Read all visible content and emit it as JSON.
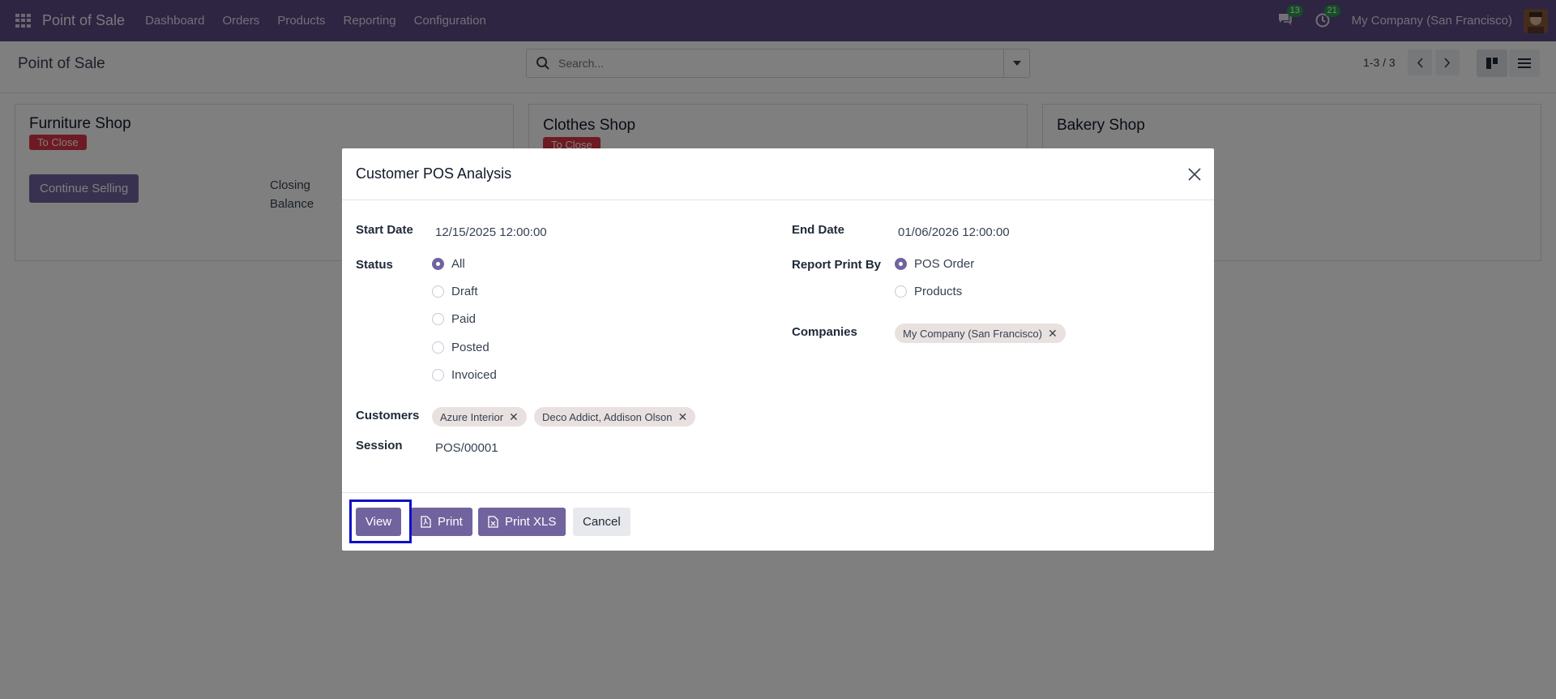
{
  "navbar": {
    "brand": "Point of Sale",
    "menu": [
      "Dashboard",
      "Orders",
      "Products",
      "Reporting",
      "Configuration"
    ],
    "messages_count": "13",
    "activities_count": "21",
    "company": "My Company (San Francisco)"
  },
  "control_panel": {
    "title": "Point of Sale",
    "search_placeholder": "Search...",
    "pager": "1-3 / 3"
  },
  "cards": [
    {
      "title": "Furniture Shop",
      "status": "To Close",
      "button": "Continue Selling",
      "closing_label": "Closing Balance"
    },
    {
      "title": "Clothes Shop",
      "status": "To Close"
    },
    {
      "title": "Bakery Shop"
    }
  ],
  "dialog": {
    "title": "Customer POS Analysis",
    "start_date_label": "Start Date",
    "start_date": "12/15/2025 12:00:00",
    "end_date_label": "End Date",
    "end_date": "01/06/2026 12:00:00",
    "status_label": "Status",
    "status_options": [
      "All",
      "Draft",
      "Paid",
      "Posted",
      "Invoiced"
    ],
    "status_selected": "All",
    "report_print_by_label": "Report Print By",
    "report_options": [
      "POS Order",
      "Products"
    ],
    "report_selected": "POS Order",
    "companies_label": "Companies",
    "companies": [
      "My Company (San Francisco)"
    ],
    "customers_label": "Customers",
    "customers": [
      "Azure Interior",
      "Deco Addict, Addison Olson"
    ],
    "session_label": "Session",
    "session": "POS/00001",
    "buttons": {
      "view": "View",
      "print": "Print",
      "print_xls": "Print XLS",
      "cancel": "Cancel"
    }
  },
  "colors": {
    "navbar": "#5b4a85",
    "primary": "#71639e",
    "danger": "#dc3545",
    "highlight": "#1010c8"
  }
}
